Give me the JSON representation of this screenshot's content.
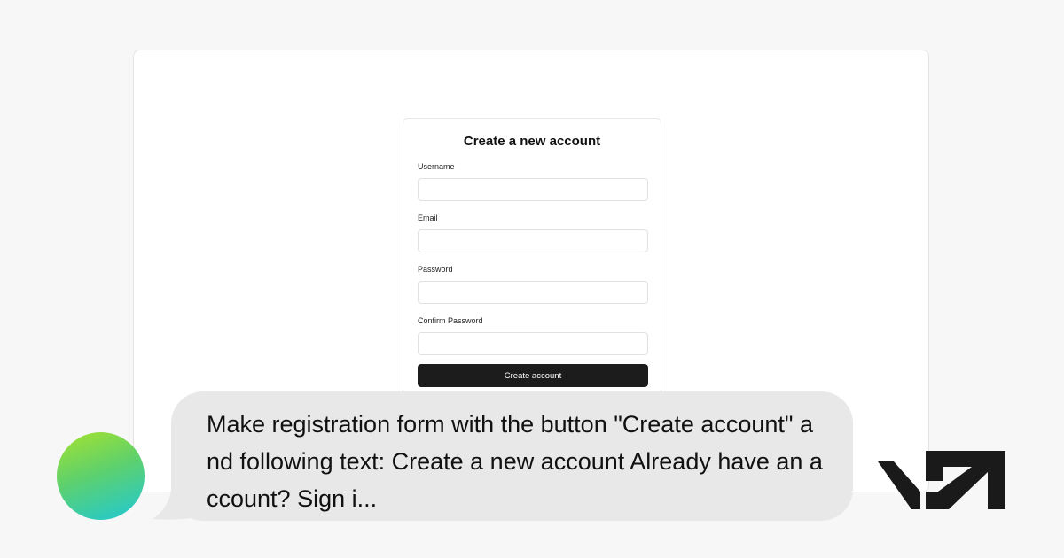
{
  "form": {
    "title": "Create a new account",
    "fields": [
      {
        "label": "Username",
        "value": "",
        "placeholder": ""
      },
      {
        "label": "Email",
        "value": "",
        "placeholder": ""
      },
      {
        "label": "Password",
        "value": "",
        "placeholder": ""
      },
      {
        "label": "Confirm Password",
        "value": "",
        "placeholder": ""
      }
    ],
    "submit_label": "Create account"
  },
  "prompt": {
    "text": "Make registration form with the button \"Create account\" and following text: Create a new account Already have an account? Sign i..."
  },
  "avatar": {
    "icon": "gradient-avatar-icon",
    "colors": [
      "#a6e22e",
      "#1ec8d6"
    ]
  },
  "brand": {
    "icon": "v0-logo-icon",
    "color": "#1a1a1a"
  },
  "colors": {
    "page_background": "#f7f7f7",
    "button_background": "#1c1c1c",
    "bubble_background": "#e8e8e9"
  }
}
